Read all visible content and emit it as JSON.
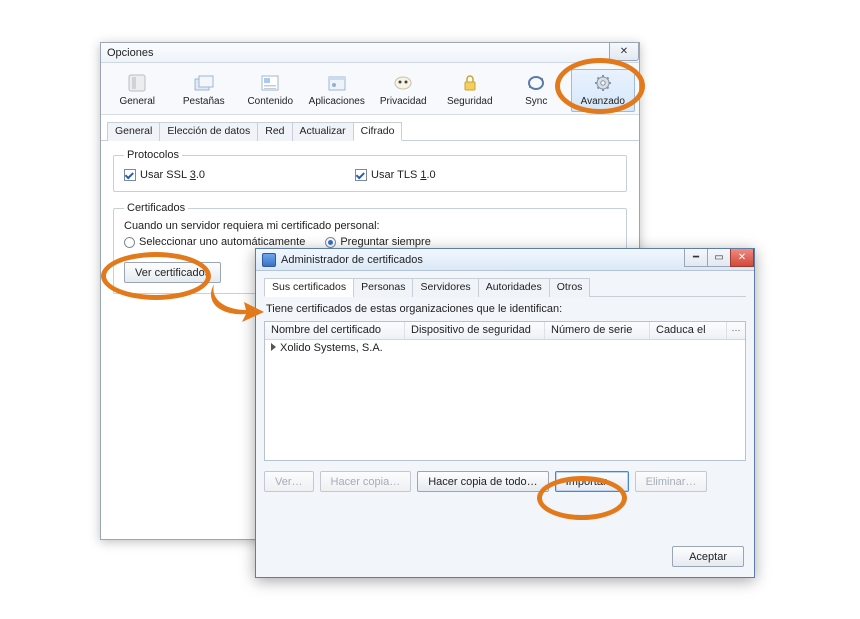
{
  "options": {
    "title": "Opciones",
    "toolbar": [
      {
        "label": "General"
      },
      {
        "label": "Pestañas"
      },
      {
        "label": "Contenido"
      },
      {
        "label": "Aplicaciones"
      },
      {
        "label": "Privacidad"
      },
      {
        "label": "Seguridad"
      },
      {
        "label": "Sync"
      },
      {
        "label": "Avanzado"
      }
    ],
    "subtabs": [
      {
        "label": "General"
      },
      {
        "label": "Elección de datos"
      },
      {
        "label": "Red"
      },
      {
        "label": "Actualizar"
      },
      {
        "label": "Cifrado"
      }
    ],
    "protocols": {
      "legend": "Protocolos",
      "ssl_pre": "Usar SSL ",
      "ssl_key": "3",
      "ssl_post": ".0",
      "tls_pre": "Usar TLS ",
      "tls_key": "1",
      "tls_post": ".0"
    },
    "certificates": {
      "legend": "Certificados",
      "prompt": "Cuando un servidor requiera mi certificado personal:",
      "radio_auto": "Seleccionar uno automáticamente",
      "radio_ask": "Preguntar siempre",
      "view_btn": "Ver certificados"
    }
  },
  "certmgr": {
    "title": "Administrador de certificados",
    "tabs": [
      {
        "label": "Sus certificados"
      },
      {
        "label": "Personas"
      },
      {
        "label": "Servidores"
      },
      {
        "label": "Autoridades"
      },
      {
        "label": "Otros"
      }
    ],
    "caption": "Tiene certificados de estas organizaciones que le identifican:",
    "columns": {
      "name": "Nombre del certificado",
      "device": "Dispositivo de seguridad",
      "serial": "Número de serie",
      "expires": "Caduca el"
    },
    "row0_org": "Xolido Systems, S.A.",
    "buttons": {
      "view": "Ver…",
      "backup": "Hacer copia…",
      "backup_all": "Hacer copia de todo…",
      "import": "Importar…",
      "delete": "Eliminar…"
    },
    "accept": "Aceptar"
  }
}
